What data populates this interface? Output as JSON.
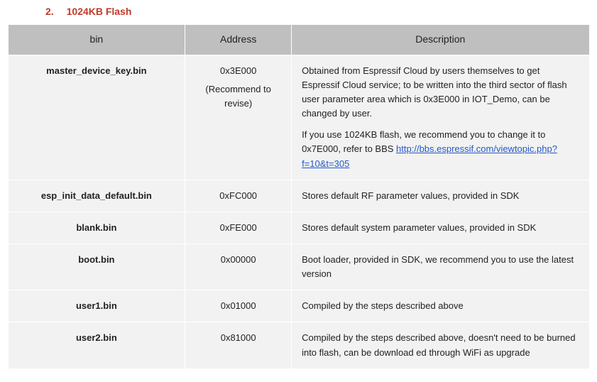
{
  "heading": {
    "number": "2.",
    "title": "1024KB Flash"
  },
  "table": {
    "headers": {
      "bin": "bin",
      "address": "Address",
      "description": "Description"
    },
    "rows": [
      {
        "bin": "master_device_key.bin",
        "address": "0x3E000",
        "address_note": "(Recommend to revise)",
        "desc1": "Obtained from Espressif Cloud by users themselves to get Espressif Cloud service; to be written into the third sector of flash user parameter area which is 0x3E000 in IOT_Demo, can be changed by user.",
        "desc2_pre": "If you use 1024KB flash, we recommend you to change it to 0x7E000, refer to BBS ",
        "desc2_link": "http://bbs.espressif.com/viewtopic.php?f=10&t=305"
      },
      {
        "bin": "esp_init_data_default.bin",
        "address": "0xFC000",
        "desc": "Stores default RF parameter values, provided in SDK"
      },
      {
        "bin": "blank.bin",
        "address": "0xFE000",
        "desc": "Stores default system parameter values, provided in SDK"
      },
      {
        "bin": "boot.bin",
        "address": "0x00000",
        "desc": "Boot loader, provided in SDK, we recommend you to use the latest version"
      },
      {
        "bin": "user1.bin",
        "address": "0x01000",
        "desc": "Compiled by the steps described above"
      },
      {
        "bin": "user2.bin",
        "address": "0x81000",
        "desc": "Compiled by the steps described above, doesn't need to be burned into flash, can be download ed through WiFi as upgrade"
      }
    ]
  }
}
